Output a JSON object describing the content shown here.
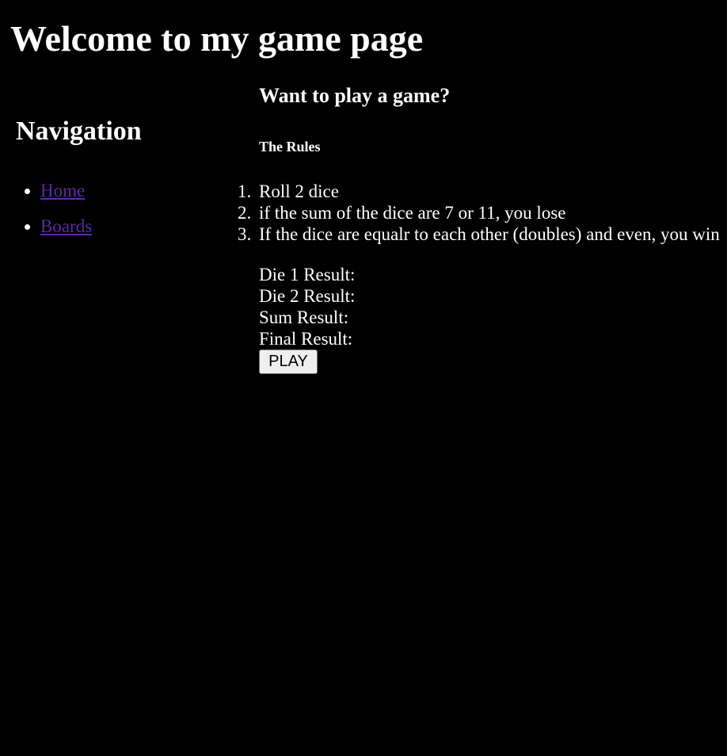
{
  "header": {
    "title": "Welcome to my game page"
  },
  "nav": {
    "heading": "Navigation",
    "items": [
      {
        "label": "Home"
      },
      {
        "label": "Boards"
      }
    ]
  },
  "main": {
    "heading": "Want to play a game?",
    "rules_heading": "The Rules",
    "rules": [
      {
        "number": "1.",
        "text": "Roll 2 dice"
      },
      {
        "number": "2.",
        "text": "if the sum of the dice are 7 or 11, you lose"
      },
      {
        "number": "3.",
        "text": "If the dice are equalr to each other (doubles) and even, you win"
      }
    ],
    "results": {
      "die1": "Die 1 Result:",
      "die2": "Die 2 Result:",
      "sum": "Sum Result:",
      "final": "Final Result:"
    },
    "play_label": "PLAY"
  },
  "colors": {
    "background": "#000000",
    "text": "#ffffff",
    "link": "#5b2aa6"
  }
}
